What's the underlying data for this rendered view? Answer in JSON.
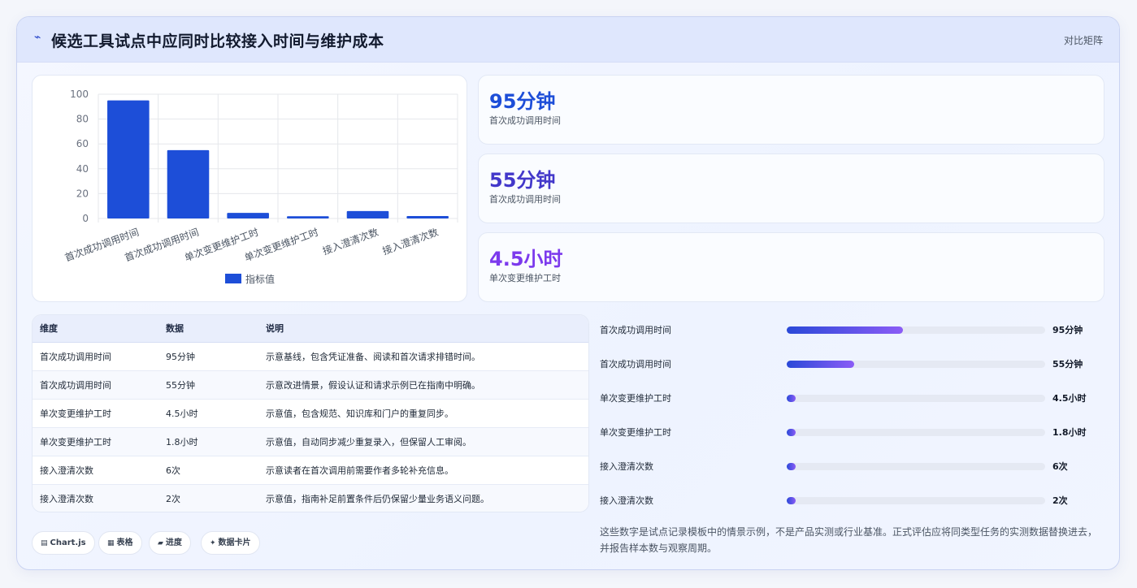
{
  "header": {
    "icon": "trend-line-icon",
    "title": "候选工具试点中应同时比较接入时间与维护成本",
    "link_label": "对比矩阵"
  },
  "chart_data": {
    "type": "bar",
    "categories": [
      "首次成功调用时间",
      "首次成功调用时间",
      "单次变更维护工时",
      "单次变更维护工时",
      "接入澄清次数",
      "接入澄清次数"
    ],
    "series": [
      {
        "name": "指标值",
        "values": [
          95,
          55,
          4.5,
          1.8,
          6,
          2
        ],
        "color": "#1d4ed8"
      }
    ],
    "ylim": [
      0,
      100
    ],
    "yticks": [
      0,
      20,
      40,
      60,
      80,
      100
    ],
    "grid": true,
    "legend": "bottom"
  },
  "stats": [
    {
      "value": "95分钟",
      "label": "首次成功调用时间",
      "color": "#1d4ed8"
    },
    {
      "value": "55分钟",
      "label": "首次成功调用时间",
      "color": "#4338ca"
    },
    {
      "value": "4.5小时",
      "label": "单次变更维护工时",
      "color": "#7c3aed"
    }
  ],
  "table": {
    "headers": [
      "维度",
      "数据",
      "说明"
    ],
    "rows": [
      [
        "首次成功调用时间",
        "95分钟",
        "示意基线，包含凭证准备、阅读和首次请求排错时间。"
      ],
      [
        "首次成功调用时间",
        "55分钟",
        "示意改进情景，假设认证和请求示例已在指南中明确。"
      ],
      [
        "单次变更维护工时",
        "4.5小时",
        "示意值，包含规范、知识库和门户的重复同步。"
      ],
      [
        "单次变更维护工时",
        "1.8小时",
        "示意值，自动同步减少重复录入，但保留人工审阅。"
      ],
      [
        "接入澄清次数",
        "6次",
        "示意读者在首次调用前需要作者多轮补充信息。"
      ],
      [
        "接入澄清次数",
        "2次",
        "示意值，指南补足前置条件后仍保留少量业务语义问题。"
      ]
    ]
  },
  "progress": [
    {
      "label": "首次成功调用时间",
      "value": "95分钟",
      "fraction": 0.45
    },
    {
      "label": "首次成功调用时间",
      "value": "55分钟",
      "fraction": 0.26
    },
    {
      "label": "单次变更维护工时",
      "value": "4.5小时",
      "fraction": 0.02
    },
    {
      "label": "单次变更维护工时",
      "value": "1.8小时",
      "fraction": 0.01
    },
    {
      "label": "接入澄清次数",
      "value": "6次",
      "fraction": 0.02
    },
    {
      "label": "接入澄清次数",
      "value": "2次",
      "fraction": 0.01
    }
  ],
  "tags": [
    {
      "icon": "chart-icon",
      "glyph": "▤",
      "label": "Chart.js"
    },
    {
      "icon": "table-icon",
      "glyph": "▦",
      "label": "表格"
    },
    {
      "icon": "progress-icon",
      "glyph": "▰",
      "label": "进度"
    },
    {
      "icon": "card-icon",
      "glyph": "✦",
      "label": "数据卡片"
    }
  ],
  "note": "这些数字是试点记录模板中的情景示例，不是产品实测或行业基准。正式评估应将同类型任务的实测数据替换进去，并报告样本数与观察周期。"
}
